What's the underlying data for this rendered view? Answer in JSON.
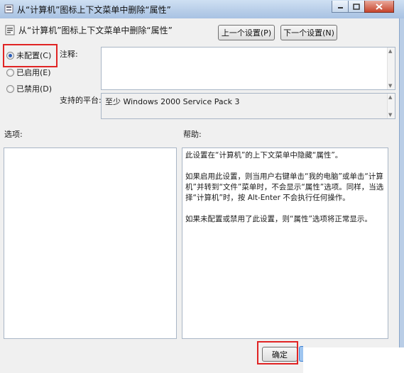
{
  "window": {
    "title": "从“计算机”图标上下文菜单中删除“属性”"
  },
  "policy": {
    "title": "从“计算机”图标上下文菜单中删除“属性”",
    "prev_button": "上一个设置(P)",
    "next_button": "下一个设置(N)"
  },
  "state": {
    "options": [
      {
        "label": "未配置(C)",
        "checked": true
      },
      {
        "label": "已启用(E)",
        "checked": false
      },
      {
        "label": "已禁用(D)",
        "checked": false
      }
    ]
  },
  "comment": {
    "label": "注释:",
    "value": ""
  },
  "platform": {
    "label": "支持的平台:",
    "value": "至少 Windows 2000 Service Pack 3"
  },
  "options_panel": {
    "label": "选项:"
  },
  "help_panel": {
    "label": "帮助:",
    "paragraphs": [
      "此设置在“计算机”的上下文菜单中隐藏“属性”。",
      "如果启用此设置，则当用户右键单击“我的电脑”或单击“计算机”并转到“文件”菜单时，不会显示“属性”选项。同样，当选择“计算机”时，按 Alt-Enter 不会执行任何操作。",
      "如果未配置或禁用了此设置，则“属性”选项将正常显示。"
    ]
  },
  "footer": {
    "ok_button": "确定"
  },
  "colors": {
    "highlight": "#e02424",
    "dialog_bg": "#f0f0f0"
  }
}
